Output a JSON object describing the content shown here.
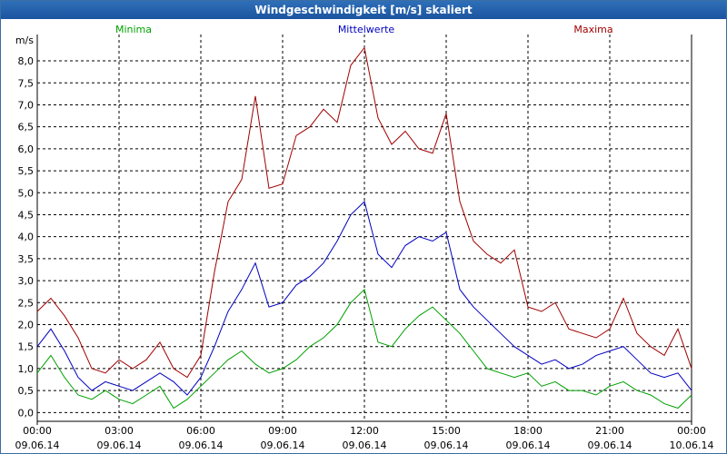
{
  "window": {
    "title": "Windgeschwindigkeit [m/s] skaliert"
  },
  "chart_data": {
    "type": "line",
    "title": "Windgeschwindigkeit [m/s] skaliert",
    "ylabel": "m/s",
    "xlabel": "",
    "ylim": [
      -0.2,
      8.6
    ],
    "yticks": [
      "0,0",
      "0,5",
      "1,0",
      "1,5",
      "2,0",
      "2,5",
      "3,0",
      "3,5",
      "4,0",
      "4,5",
      "5,0",
      "5,5",
      "6,0",
      "6,5",
      "7,0",
      "7,5",
      "8,0"
    ],
    "xticks": [
      {
        "time": "00:00",
        "date": "09.06.14"
      },
      {
        "time": "03:00",
        "date": "09.06.14"
      },
      {
        "time": "06:00",
        "date": "09.06.14"
      },
      {
        "time": "09:00",
        "date": "09.06.14"
      },
      {
        "time": "12:00",
        "date": "09.06.14"
      },
      {
        "time": "15:00",
        "date": "09.06.14"
      },
      {
        "time": "18:00",
        "date": "09.06.14"
      },
      {
        "time": "21:00",
        "date": "09.06.14"
      },
      {
        "time": "00:00",
        "date": "10.06.14"
      }
    ],
    "x_hours": [
      0,
      0.5,
      1,
      1.5,
      2,
      2.5,
      3,
      3.5,
      4,
      4.5,
      5,
      5.5,
      6,
      6.5,
      7,
      7.5,
      8,
      8.5,
      9,
      9.5,
      10,
      10.5,
      11,
      11.5,
      12,
      12.5,
      13,
      13.5,
      14,
      14.5,
      15,
      15.5,
      16,
      16.5,
      17,
      17.5,
      18,
      18.5,
      19,
      19.5,
      20,
      20.5,
      21,
      21.5,
      22,
      22.5,
      23,
      23.5,
      24
    ],
    "grid": true,
    "legend_placement": "top",
    "series": [
      {
        "name": "Minima",
        "color": "#00a000",
        "values": [
          0.9,
          1.3,
          0.8,
          0.4,
          0.3,
          0.5,
          0.3,
          0.2,
          0.4,
          0.6,
          0.1,
          0.3,
          0.6,
          0.9,
          1.2,
          1.4,
          1.1,
          0.9,
          1.0,
          1.2,
          1.5,
          1.7,
          2.0,
          2.5,
          2.8,
          1.6,
          1.5,
          1.9,
          2.2,
          2.4,
          2.1,
          1.8,
          1.4,
          1.0,
          0.9,
          0.8,
          0.9,
          0.6,
          0.7,
          0.5,
          0.5,
          0.4,
          0.6,
          0.7,
          0.5,
          0.4,
          0.2,
          0.1,
          0.4
        ]
      },
      {
        "name": "Mittelwerte",
        "color": "#0000c0",
        "values": [
          1.5,
          1.9,
          1.4,
          0.8,
          0.5,
          0.7,
          0.6,
          0.5,
          0.7,
          0.9,
          0.7,
          0.4,
          0.8,
          1.5,
          2.3,
          2.8,
          3.4,
          2.4,
          2.5,
          2.9,
          3.1,
          3.4,
          3.9,
          4.5,
          4.8,
          3.6,
          3.3,
          3.8,
          4.0,
          3.9,
          4.1,
          2.8,
          2.4,
          2.1,
          1.8,
          1.5,
          1.3,
          1.1,
          1.2,
          1.0,
          1.1,
          1.3,
          1.4,
          1.5,
          1.2,
          0.9,
          0.8,
          0.9,
          0.5
        ]
      },
      {
        "name": "Maxima",
        "color": "#a00000",
        "values": [
          2.3,
          2.6,
          2.2,
          1.7,
          1.0,
          0.9,
          1.2,
          1.0,
          1.2,
          1.6,
          1.0,
          0.8,
          1.3,
          3.2,
          4.8,
          5.3,
          7.2,
          5.1,
          5.2,
          6.3,
          6.5,
          6.9,
          6.6,
          7.9,
          8.3,
          6.7,
          6.1,
          6.4,
          6.0,
          5.9,
          6.8,
          4.8,
          3.9,
          3.6,
          3.4,
          3.7,
          2.4,
          2.3,
          2.5,
          1.9,
          1.8,
          1.7,
          1.9,
          2.6,
          1.8,
          1.5,
          1.3,
          1.9,
          1.0
        ]
      }
    ]
  }
}
